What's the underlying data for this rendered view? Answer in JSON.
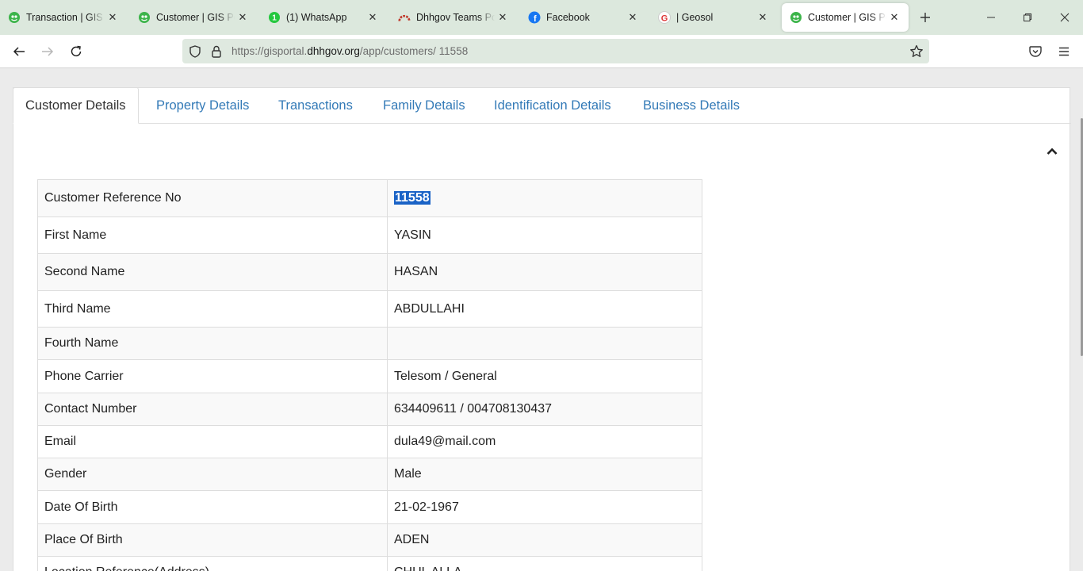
{
  "browser": {
    "tabs": [
      {
        "title": "Transaction | GIS Portal",
        "icon": "gis-portal-icon",
        "active": false
      },
      {
        "title": "Customer | GIS Portal",
        "icon": "gis-portal-icon",
        "active": false
      },
      {
        "title": "(1) WhatsApp",
        "icon": "whatsapp-icon",
        "active": false
      },
      {
        "title": "Dhhgov Teams Portal",
        "icon": "teams-portal-icon",
        "active": false
      },
      {
        "title": "Facebook",
        "icon": "facebook-icon",
        "active": false
      },
      {
        "title": "| Geosol",
        "icon": "geosol-icon",
        "active": false
      },
      {
        "title": "Customer | GIS Portal",
        "icon": "gis-portal-icon",
        "active": true
      }
    ],
    "url": {
      "prefix": "https://gisportal.",
      "domain": "dhhgov.org",
      "path": "/app/customers/ 11558"
    }
  },
  "page_tabs": [
    {
      "label": "Customer Details",
      "active": true
    },
    {
      "label": "Property Details",
      "active": false
    },
    {
      "label": "Transactions",
      "active": false
    },
    {
      "label": "Family Details",
      "active": false
    },
    {
      "label": "Identification Details",
      "active": false
    },
    {
      "label": "Business Details",
      "active": false
    }
  ],
  "customer": {
    "rows": [
      {
        "label": "Customer Reference No",
        "value": "11558",
        "selected": true
      },
      {
        "label": "First Name",
        "value": "YASIN"
      },
      {
        "label": "Second Name",
        "value": "HASAN"
      },
      {
        "label": "Third Name",
        "value": "ABDULLAHI"
      },
      {
        "label": "Fourth Name",
        "value": ""
      },
      {
        "label": "Phone Carrier",
        "value": "Telesom / General"
      },
      {
        "label": "Contact Number",
        "value": "634409611 / 004708130437"
      },
      {
        "label": "Email",
        "value": "dula49@mail.com"
      },
      {
        "label": "Gender",
        "value": "Male"
      },
      {
        "label": "Date Of Birth",
        "value": "21-02-1967"
      },
      {
        "label": "Place Of Birth",
        "value": "ADEN"
      },
      {
        "label": "Location Reference(Address)",
        "value": "CHUL ALLA"
      }
    ]
  },
  "colors": {
    "link": "#337ab7",
    "selection": "#1a63c6",
    "tabstrip": "#dce8dd",
    "urlbar": "#dfe9e0"
  }
}
